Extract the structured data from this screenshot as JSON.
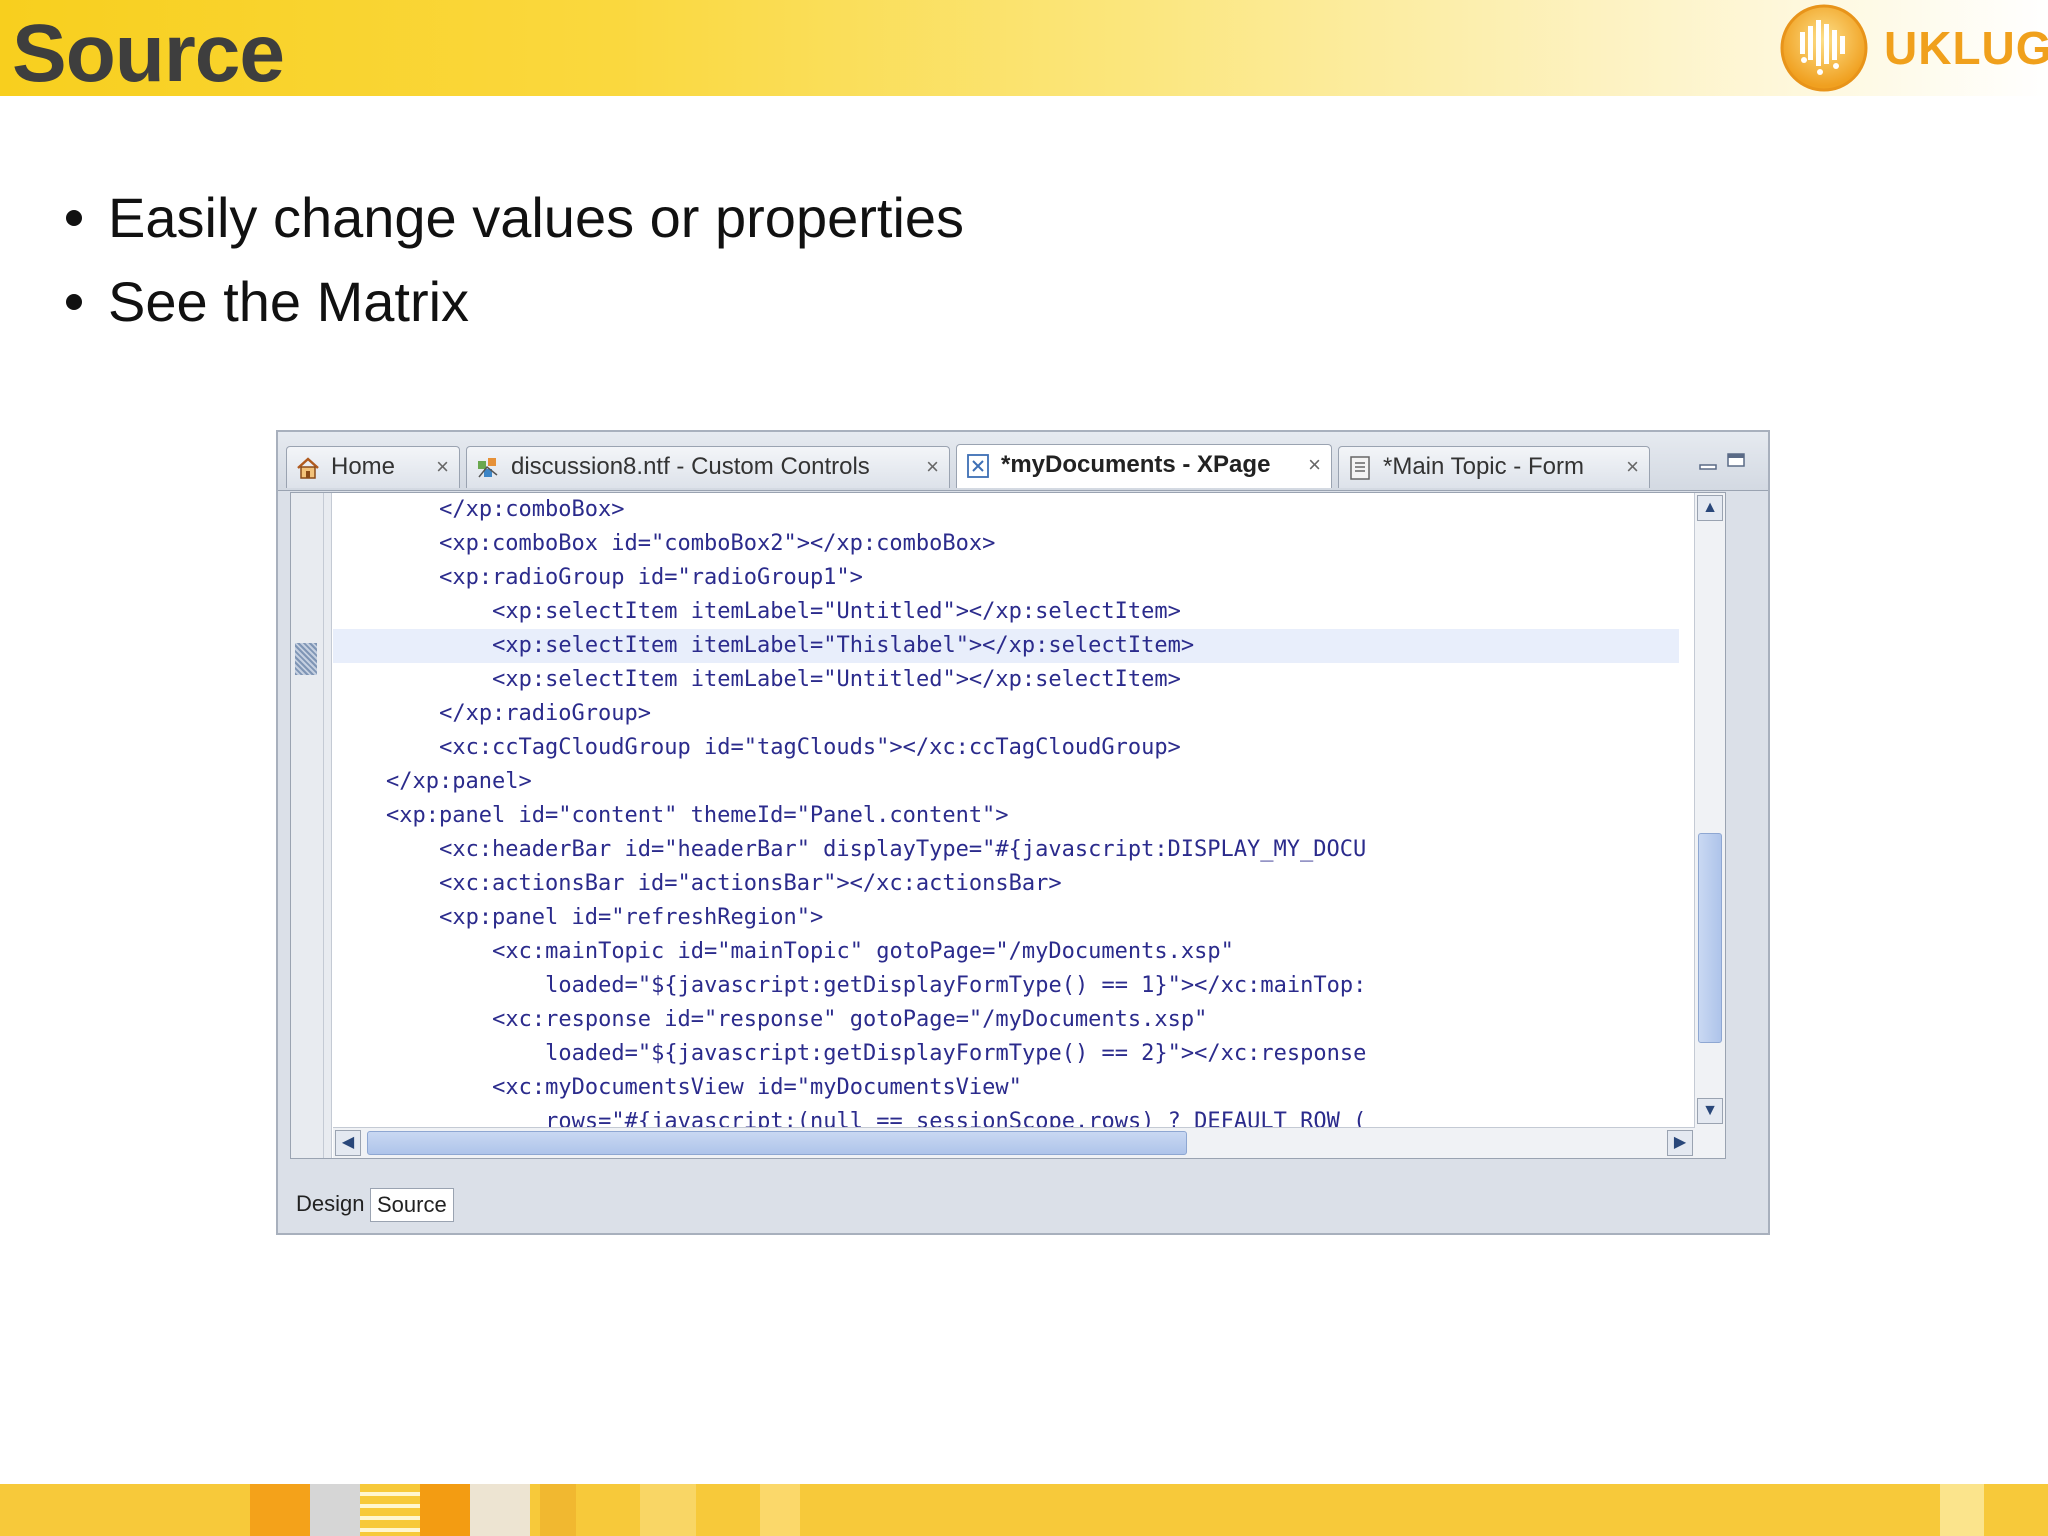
{
  "slide": {
    "title": "Source",
    "logo_text": "UKLUG",
    "bullets": [
      "Easily change values or properties",
      "See the Matrix"
    ]
  },
  "ide": {
    "tabs": [
      {
        "label": "Home",
        "icon": "home-icon",
        "active": false
      },
      {
        "label": "discussion8.ntf - Custom Controls",
        "icon": "custom-controls-icon",
        "active": false
      },
      {
        "label": "*myDocuments - XPage",
        "icon": "xpage-icon",
        "active": true
      },
      {
        "label": "*Main Topic - Form",
        "icon": "form-icon",
        "active": false
      }
    ],
    "close_glyph": "×",
    "code_lines": [
      {
        "indent": 8,
        "text": "</xp:comboBox>"
      },
      {
        "indent": 8,
        "text": "<xp:comboBox id=\"comboBox2\"></xp:comboBox>"
      },
      {
        "indent": 8,
        "text": "<xp:radioGroup id=\"radioGroup1\">"
      },
      {
        "indent": 12,
        "text": "<xp:selectItem itemLabel=\"Untitled\"></xp:selectItem>"
      },
      {
        "indent": 12,
        "text": "<xp:selectItem itemLabel=\"Thislabel\"></xp:selectItem>"
      },
      {
        "indent": 12,
        "text": "<xp:selectItem itemLabel=\"Untitled\"></xp:selectItem>"
      },
      {
        "indent": 8,
        "text": "</xp:radioGroup>"
      },
      {
        "indent": 8,
        "text": "<xc:ccTagCloudGroup id=\"tagClouds\"></xc:ccTagCloudGroup>"
      },
      {
        "indent": 4,
        "text": "</xp:panel>"
      },
      {
        "indent": 4,
        "text": "<xp:panel id=\"content\" themeId=\"Panel.content\">"
      },
      {
        "indent": 8,
        "text": "<xc:headerBar id=\"headerBar\" displayType=\"#{javascript:DISPLAY_MY_DOCU"
      },
      {
        "indent": 8,
        "text": "<xc:actionsBar id=\"actionsBar\"></xc:actionsBar>"
      },
      {
        "indent": 8,
        "text": "<xp:panel id=\"refreshRegion\">"
      },
      {
        "indent": 12,
        "text": "<xc:mainTopic id=\"mainTopic\" gotoPage=\"/myDocuments.xsp\""
      },
      {
        "indent": 16,
        "text": "loaded=\"${javascript:getDisplayFormType() == 1}\"></xc:mainTop:"
      },
      {
        "indent": 12,
        "text": "<xc:response id=\"response\" gotoPage=\"/myDocuments.xsp\""
      },
      {
        "indent": 16,
        "text": "loaded=\"${javascript:getDisplayFormType() == 2}\"></xc:response"
      },
      {
        "indent": 12,
        "text": "<xc:myDocumentsView id=\"myDocumentsView\""
      },
      {
        "indent": 16,
        "text": "rows=\"#{javascript:(null == sessionScope.rows) ? DEFAULT_ROW_("
      }
    ],
    "highlighted_line": 4,
    "bottom_tabs": [
      {
        "label": "Design",
        "active": false
      },
      {
        "label": "Source",
        "active": true
      }
    ],
    "colors": {
      "code_text": "#2b2b8c",
      "highlight": "#e8eefb",
      "header_yellow": "#f8cf1e"
    }
  }
}
